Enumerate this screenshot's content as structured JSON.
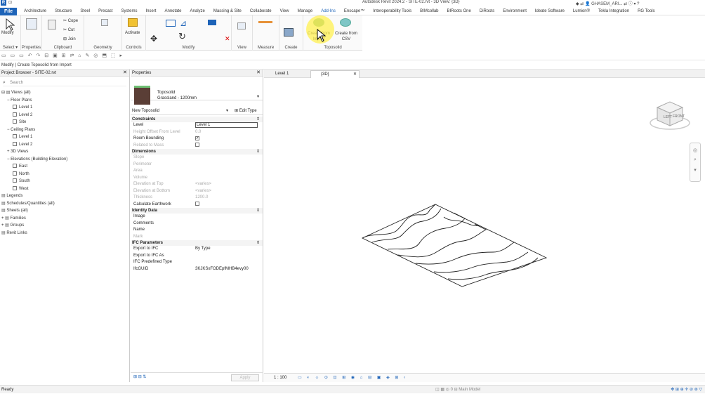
{
  "app": {
    "title": "Autodesk Revit 2024.2 - SITE-02.rvt - 3D View: {3D}",
    "user": "GHASEM_ARI..."
  },
  "ribbon": {
    "tabs": [
      "File",
      "Architecture",
      "Structure",
      "Steel",
      "Precast",
      "Systems",
      "Insert",
      "Annotate",
      "Analyze",
      "Massing & Site",
      "Collaborate",
      "View",
      "Manage",
      "Add-Ins",
      "Enscape™",
      "Interoperability Tools",
      "BIMcollab",
      "BIRoots One",
      "DiRoots",
      "Environment",
      "Ideate Software",
      "Lumion®",
      "Tekla Integration",
      "RG Tools"
    ],
    "active_tab": "Add-Ins",
    "groups": {
      "select": "Select",
      "properties": "Properties",
      "clipboard": "Clipboard",
      "geometry": "Geometry",
      "controls": "Controls",
      "modify": "Modify",
      "view": "View",
      "measure": "Measure",
      "create": "Create",
      "toposolid": "Toposolid"
    },
    "buttons": {
      "modify": "Modify",
      "cope": "Cope",
      "cut": "Cut",
      "join": "Join",
      "activate": "Activate",
      "create_from_import": "Create from Import",
      "create_from_csv": "Create from CSV"
    }
  },
  "status_line": "Modify | Create Toposolid from Import",
  "project_browser": {
    "title": "Project Browser - SITE-02.rvt",
    "search_placeholder": "Search",
    "tree": [
      {
        "label": "Views (all)",
        "indent": 0,
        "prefix": "⊟",
        "icon": "views"
      },
      {
        "label": "Floor Plans",
        "indent": 1,
        "prefix": "−"
      },
      {
        "label": "Level 1",
        "indent": 2,
        "prefix": "",
        "box": true
      },
      {
        "label": "Level 2",
        "indent": 2,
        "prefix": "",
        "box": true
      },
      {
        "label": "Site",
        "indent": 2,
        "prefix": "",
        "box": true
      },
      {
        "label": "Ceiling Plans",
        "indent": 1,
        "prefix": "−"
      },
      {
        "label": "Level 1",
        "indent": 2,
        "prefix": "",
        "box": true
      },
      {
        "label": "Level 2",
        "indent": 2,
        "prefix": "",
        "box": true
      },
      {
        "label": "3D Views",
        "indent": 1,
        "prefix": "+"
      },
      {
        "label": "Elevations (Building Elevation)",
        "indent": 1,
        "prefix": "−"
      },
      {
        "label": "East",
        "indent": 2,
        "prefix": "",
        "box": true
      },
      {
        "label": "North",
        "indent": 2,
        "prefix": "",
        "box": true
      },
      {
        "label": "South",
        "indent": 2,
        "prefix": "",
        "box": true
      },
      {
        "label": "West",
        "indent": 2,
        "prefix": "",
        "box": true
      },
      {
        "label": "Legends",
        "indent": 0,
        "prefix": "",
        "icon": "legend"
      },
      {
        "label": "Schedules/Quantities (all)",
        "indent": 0,
        "prefix": "",
        "icon": "schedule"
      },
      {
        "label": "Sheets (all)",
        "indent": 0,
        "prefix": "",
        "icon": "sheet"
      },
      {
        "label": "Families",
        "indent": 0,
        "prefix": "+",
        "icon": "family"
      },
      {
        "label": "Groups",
        "indent": 0,
        "prefix": "+",
        "icon": "group"
      },
      {
        "label": "Revit Links",
        "indent": 0,
        "prefix": "",
        "icon": "link"
      }
    ]
  },
  "properties": {
    "title": "Properties",
    "family": "Toposolid",
    "type": "Grassland - 1200mm",
    "instance_filter": "New Toposolid",
    "edit_type": "Edit Type",
    "sections": [
      {
        "name": "Constraints",
        "rows": [
          {
            "label": "Level",
            "value": "Level 1",
            "kind": "input"
          },
          {
            "label": "Height Offset From Level",
            "value": "0.0",
            "dim": true
          },
          {
            "label": "Room Bounding",
            "value": "✔",
            "kind": "check"
          },
          {
            "label": "Related to Mass",
            "value": "",
            "kind": "check",
            "dim": true
          }
        ]
      },
      {
        "name": "Dimensions",
        "rows": [
          {
            "label": "Slope",
            "value": "",
            "dim": true
          },
          {
            "label": "Perimeter",
            "value": "",
            "dim": true
          },
          {
            "label": "Area",
            "value": "",
            "dim": true
          },
          {
            "label": "Volume",
            "value": "",
            "dim": true
          },
          {
            "label": "Elevation at Top",
            "value": "<varies>",
            "dim": true
          },
          {
            "label": "Elevation at Bottom",
            "value": "<varies>",
            "dim": true
          },
          {
            "label": "Thickness",
            "value": "1200.0",
            "dim": true
          },
          {
            "label": "Calculate Earthwork",
            "value": "",
            "kind": "check"
          }
        ]
      },
      {
        "name": "Identity Data",
        "rows": [
          {
            "label": "Image",
            "value": ""
          },
          {
            "label": "Comments",
            "value": ""
          },
          {
            "label": "Name",
            "value": ""
          },
          {
            "label": "Mark",
            "value": "",
            "dim": true
          }
        ]
      },
      {
        "name": "IFC Parameters",
        "rows": [
          {
            "label": "Export to IFC",
            "value": "By Type"
          },
          {
            "label": "Export to IFC As",
            "value": ""
          },
          {
            "label": "IFC Predefined Type",
            "value": ""
          },
          {
            "label": "IfcGUID",
            "value": "3KJKSxFODEpfMHB4evy00"
          }
        ]
      }
    ],
    "apply": "Apply"
  },
  "viewport": {
    "tabs": [
      {
        "label": "Level 1",
        "active": false
      },
      {
        "label": "{3D}",
        "active": true
      }
    ],
    "scale": "1 : 100",
    "viewcube": {
      "left": "LEFT",
      "front": "FRONT"
    }
  },
  "statusbar": {
    "left": "Ready",
    "right": "Main Model"
  }
}
